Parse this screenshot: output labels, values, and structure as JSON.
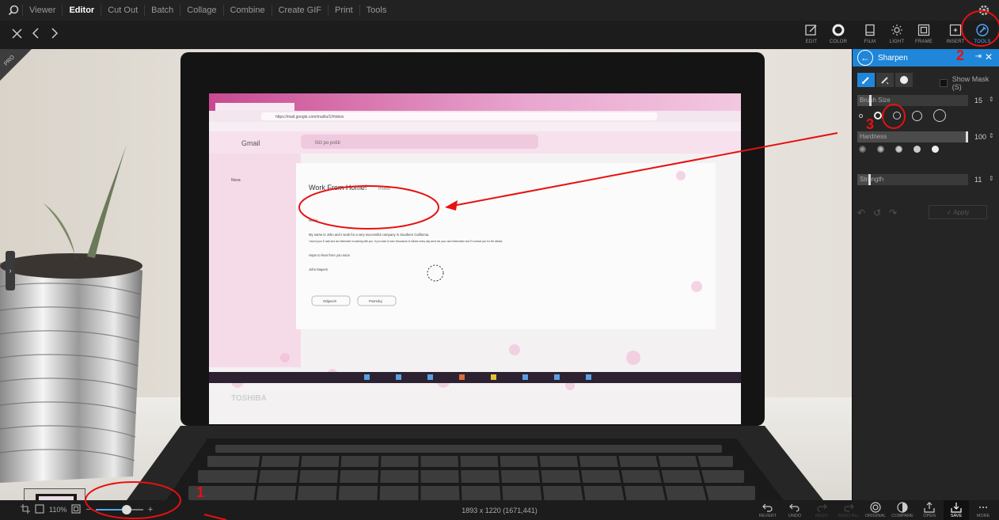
{
  "menubar": {
    "items": [
      "Viewer",
      "Editor",
      "Cut Out",
      "Batch",
      "Collage",
      "Combine",
      "Create GIF",
      "Print",
      "Tools"
    ],
    "active": "Editor"
  },
  "toolbar": {
    "tools": [
      {
        "label": "EDIT",
        "icon": "edit-icon"
      },
      {
        "label": "COLOR",
        "icon": "color-icon"
      },
      {
        "label": "FILM",
        "icon": "film-icon"
      },
      {
        "label": "LIGHT",
        "icon": "light-icon"
      },
      {
        "label": "FRAME",
        "icon": "frame-icon"
      },
      {
        "label": "INSERT",
        "icon": "insert-icon"
      },
      {
        "label": "TOOLS",
        "icon": "tools-icon"
      }
    ],
    "active": "TOOLS",
    "accent": "#4ea8ff"
  },
  "photo": {
    "laptop_brand": "TOSHIBA",
    "email_subject": "Work From Home!",
    "email_badge": "Promo",
    "email_body_1": "My name is John and I work for a very successful company in Southern California.",
    "email_body_2": "I found your E-mail and am interested in working with you. If you want to earn thousands of dollars every day send me your card information and I'll contact you for the details.",
    "email_body_3": "Hope to hear from you soon",
    "email_sign": "John Mayers",
    "gmail_label": "Gmail",
    "search_placeholder": "Išči po pošti",
    "url": "https://mail.google.com/mail/u/1/#inbox",
    "hello": "Hello!",
    "reply": "Odgovori",
    "forward": "Posreduj",
    "compose": "Nova"
  },
  "panel": {
    "title": "Sharpen",
    "show_mask": "Show Mask (S)",
    "brush_size_label": "Brush Size",
    "brush_size_value": "15",
    "brush_size_level": 0.12,
    "hardness_label": "Hardness",
    "hardness_value": "100",
    "hardness_level": 1.0,
    "strength_label": "Strength",
    "strength_value": "11",
    "strength_level": 0.11,
    "apply_label": "✓ Apply"
  },
  "bottombar": {
    "zoom": "110%",
    "zoom_level": 0.65,
    "image_info": "1893 x 1220 (1671,441)",
    "actions": [
      {
        "label": "REVERT",
        "icon": "revert-icon",
        "enabled": true
      },
      {
        "label": "UNDO",
        "icon": "undo-icon",
        "enabled": true
      },
      {
        "label": "REDO",
        "icon": "redo-icon",
        "enabled": false
      },
      {
        "label": "REDO ALL",
        "icon": "redo-all-icon",
        "enabled": false
      },
      {
        "label": "ORIGINAL",
        "icon": "original-icon",
        "enabled": true
      },
      {
        "label": "COMPARE",
        "icon": "compare-icon",
        "enabled": true
      },
      {
        "label": "OPEN",
        "icon": "open-icon",
        "enabled": true
      },
      {
        "label": "SAVE",
        "icon": "save-icon",
        "enabled": true
      },
      {
        "label": "MORE",
        "icon": "more-icon",
        "enabled": true
      }
    ]
  },
  "annotations": {
    "marker_1": "1",
    "marker_2": "2",
    "marker_3": "3",
    "color": "#e81010"
  }
}
